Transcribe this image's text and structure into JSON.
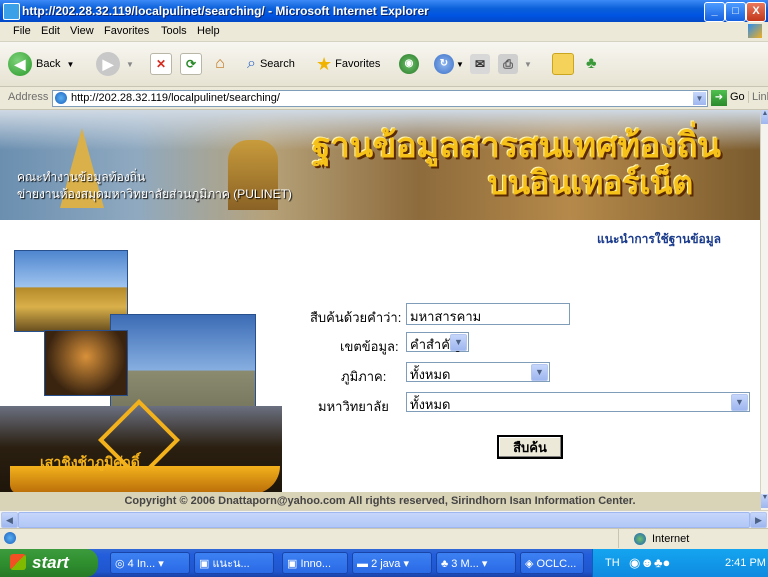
{
  "window": {
    "title": "http://202.28.32.119/localpulinet/searching/ - Microsoft Internet Explorer",
    "minimize": "_",
    "maximize": "□",
    "close": "X"
  },
  "menu": [
    "File",
    "Edit",
    "View",
    "Favorites",
    "Tools",
    "Help"
  ],
  "toolbar": {
    "back": "Back",
    "search": "Search",
    "favorites": "Favorites"
  },
  "address": {
    "label": "Address",
    "url": "http://202.28.32.119/localpulinet/searching/",
    "go": "Go",
    "links": "Links"
  },
  "page": {
    "banner_line1": "คณะทำงานข้อมูลท้องถิ่น",
    "banner_line2": "ข่ายงานห้องสมุดมหาวิทยาลัยส่วนภูมิภาค (PULINET)",
    "banner_title1": "ฐานข้อมูลสารสนเทศท้องถิ่น",
    "banner_title2": "บนอินเทอร์เน็ต",
    "guide_link": "แนะนำการใช้ฐานข้อมูล",
    "bottom_caption": "เสาชิงช้าภูมิศักดิ์",
    "form": {
      "keyword_label": "สืบค้นด้วยคำว่า:",
      "keyword_value": "มหาสารคาม",
      "scope_label": "เขตข้อมูล:",
      "scope_value": "คำสำคัญ",
      "region_label": "ภูมิภาค:",
      "region_value": "ทั้งหมด",
      "university_label": "มหาวิทยาลัย",
      "university_value": "ทั้งหมด",
      "search_button": "สืบค้น"
    },
    "footer": "Copyright © 2006 Dnattaporn@yahoo.com All rights reserved, Sirindhorn Isan Information Center."
  },
  "status": {
    "zone": "Internet"
  },
  "taskbar": {
    "start": "start",
    "tasks": [
      "4 In...",
      "แนะน...",
      "Inno...",
      "2 java",
      "3 M...",
      "OCLC..."
    ],
    "lang": "TH",
    "clock": "2:41 PM"
  }
}
